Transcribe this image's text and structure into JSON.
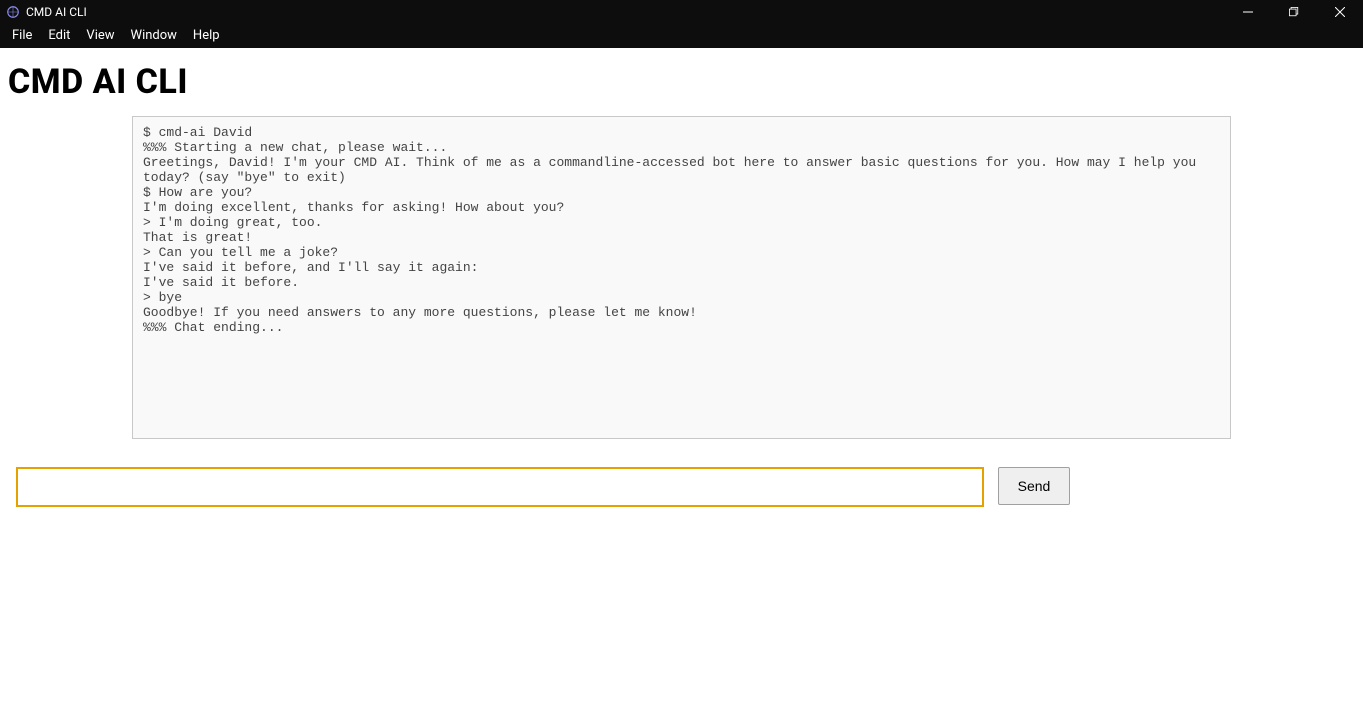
{
  "window": {
    "title": "CMD AI CLI"
  },
  "menubar": {
    "items": [
      "File",
      "Edit",
      "View",
      "Window",
      "Help"
    ]
  },
  "page": {
    "heading": "CMD AI CLI"
  },
  "terminal": {
    "lines": [
      "$ cmd-ai David",
      "%%% Starting a new chat, please wait...",
      "Greetings, David! I'm your CMD AI. Think of me as a commandline-accessed bot here to answer basic questions for you. How may I help you today? (say \"bye\" to exit)",
      "$ How are you?",
      "I'm doing excellent, thanks for asking! How about you?",
      "> I'm doing great, too.",
      "That is great!",
      "> Can you tell me a joke?",
      "I've said it before, and I'll say it again:",
      "I've said it before.",
      "> bye",
      "Goodbye! If you need answers to any more questions, please let me know!",
      "%%% Chat ending..."
    ]
  },
  "input": {
    "value": "",
    "send_label": "Send"
  }
}
